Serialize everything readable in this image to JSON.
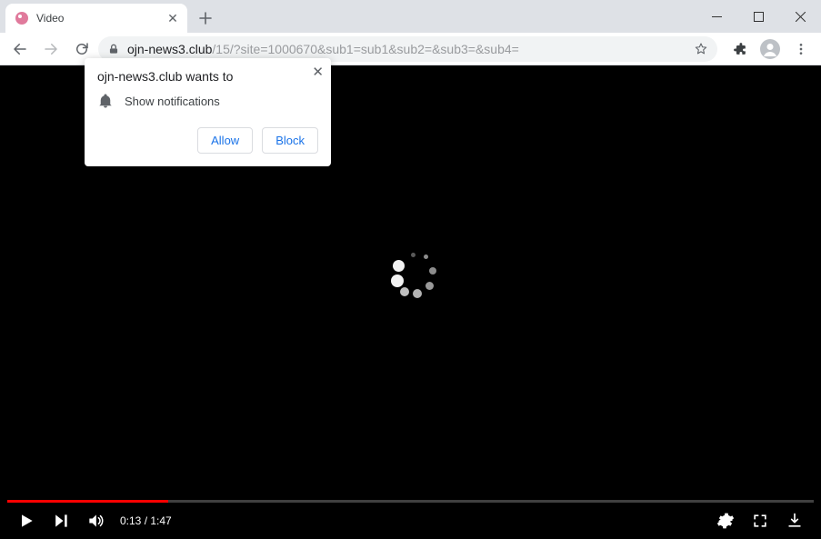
{
  "window": {
    "tab_title": "Video"
  },
  "address_bar": {
    "host": "ojn-news3.club",
    "path": "/15/?site=1000670&sub1=sub1&sub2=&sub3=&sub4="
  },
  "permission_prompt": {
    "headline": "ojn-news3.club wants to",
    "request_label": "Show notifications",
    "allow_label": "Allow",
    "block_label": "Block"
  },
  "video": {
    "current_time": "0:13",
    "duration": "1:47",
    "progress_pct": 20
  }
}
